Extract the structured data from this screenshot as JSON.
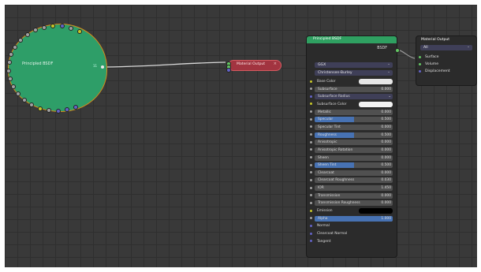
{
  "colors": {
    "canvas": "#393939",
    "node_green": "#2e9e68",
    "shader_socket": "#63c763",
    "color_socket": "#c7c729",
    "value_socket": "#a1a1a1",
    "vector_socket": "#6363c7",
    "selected_field": "#4772b3",
    "material_output_red": "#a23440"
  },
  "collapsed_node": {
    "label": "Principled BSDF",
    "badge": "11"
  },
  "material_output_collapsed": {
    "label": "Material Output",
    "close_icon": "×"
  },
  "principled": {
    "title": "Principled BSDF",
    "output_label": "BSDF",
    "distribution": "GGX",
    "subsurface_method": "Christensen-Burley",
    "inputs": [
      {
        "label": "Base Color",
        "type": "color",
        "swatch": "#e6e6e6"
      },
      {
        "label": "Subsurface",
        "type": "value",
        "value": "0.000"
      },
      {
        "label": "Subsurface Radius",
        "type": "vector_dd"
      },
      {
        "label": "Subsurface Color",
        "type": "color",
        "swatch": "#f2f2f2"
      },
      {
        "label": "Metallic",
        "type": "value",
        "value": "0.000"
      },
      {
        "label": "Specular",
        "type": "value",
        "value": "0.500",
        "fill": 0.5
      },
      {
        "label": "Specular Tint",
        "type": "value",
        "value": "0.000"
      },
      {
        "label": "Roughness",
        "type": "value",
        "value": "0.500",
        "fill": 0.5
      },
      {
        "label": "Anisotropic",
        "type": "value",
        "value": "0.000"
      },
      {
        "label": "Anisotropic Rotation",
        "type": "value",
        "value": "0.000"
      },
      {
        "label": "Sheen",
        "type": "value",
        "value": "0.000"
      },
      {
        "label": "Sheen Tint",
        "type": "value",
        "value": "0.500",
        "fill": 0.5
      },
      {
        "label": "Clearcoat",
        "type": "value",
        "value": "0.000"
      },
      {
        "label": "Clearcoat Roughness",
        "type": "value",
        "value": "0.030"
      },
      {
        "label": "IOR",
        "type": "value",
        "value": "1.450"
      },
      {
        "label": "Transmission",
        "type": "value",
        "value": "0.000"
      },
      {
        "label": "Transmission Roughness",
        "type": "value",
        "value": "0.000"
      },
      {
        "label": "Emission",
        "type": "color",
        "swatch": "#000000"
      },
      {
        "label": "Alpha",
        "type": "value",
        "value": "1.000",
        "fill": 1.0
      },
      {
        "label": "Normal",
        "type": "vector"
      },
      {
        "label": "Clearcoat Normal",
        "type": "vector"
      },
      {
        "label": "Tangent",
        "type": "vector"
      }
    ]
  },
  "output_node": {
    "title": "Material Output",
    "target": "All",
    "sockets": [
      "Surface",
      "Volume",
      "Displacement"
    ]
  }
}
